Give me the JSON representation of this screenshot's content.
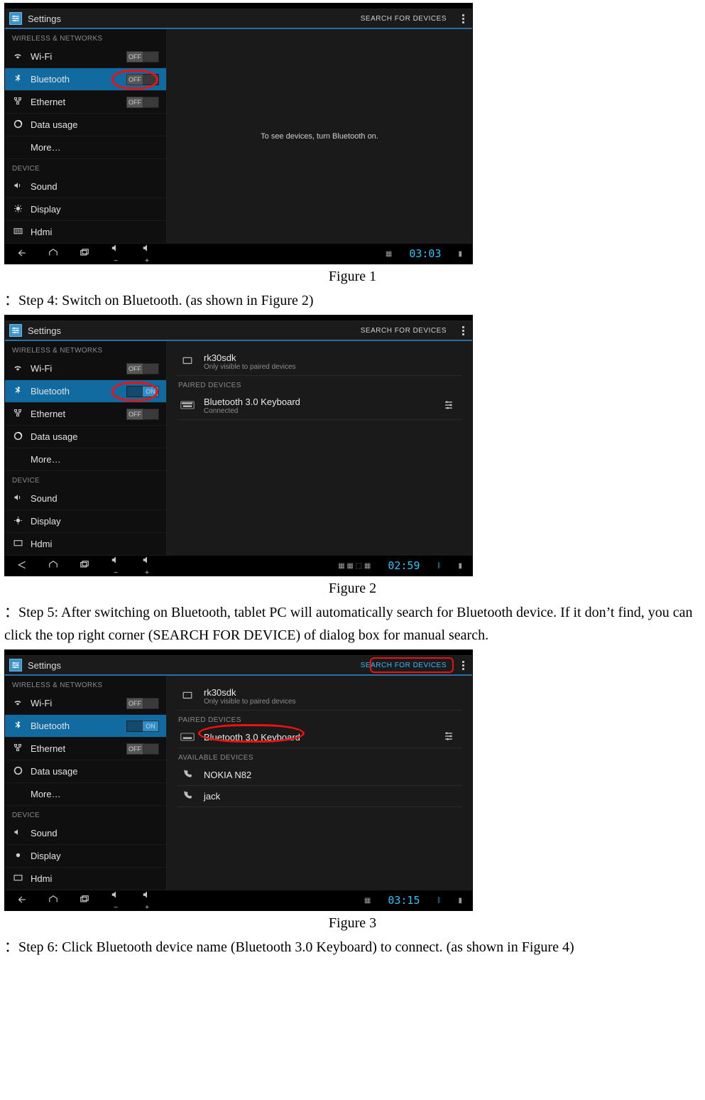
{
  "doc": {
    "captions": {
      "fig1": "Figure 1",
      "fig2": "Figure 2",
      "fig3": "Figure 3"
    },
    "steps": {
      "s4": "：Step 4: Switch on Bluetooth. (as shown in Figure 2)",
      "s5": "：Step 5: After switching on Bluetooth, tablet PC will automatically search for Bluetooth device. If it don’t find, you can click the top right corner (SEARCH FOR DEVICE) of dialog box for manual search.",
      "s6": "：Step 6: Click Bluetooth device name (Bluetooth 3.0 Keyboard) to connect. (as shown in Figure 4)"
    }
  },
  "common": {
    "app_title": "Settings",
    "search_action": "SEARCH FOR DEVICES",
    "cat_wireless": "WIRELESS & NETWORKS",
    "cat_device": "DEVICE",
    "items": {
      "wifi": "Wi-Fi",
      "bluetooth": "Bluetooth",
      "ethernet": "Ethernet",
      "data": "Data usage",
      "more": "More…",
      "sound": "Sound",
      "display": "Display",
      "hdmi": "Hdmi"
    },
    "toggle": {
      "on": "ON",
      "off": "OFF"
    }
  },
  "fig1": {
    "bt_state": "off",
    "content_msg": "To see devices, turn Bluetooth on.",
    "clock": "03:03"
  },
  "fig2": {
    "bt_state": "on",
    "self_name": "rk30sdk",
    "self_sub": "Only visible to paired devices",
    "section_paired": "PAIRED DEVICES",
    "paired": {
      "name": "Bluetooth 3.0 Keyboard",
      "sub": "Connected"
    },
    "clock": "02:59"
  },
  "fig3": {
    "bt_state": "on",
    "self_name": "rk30sdk",
    "self_sub": "Only visible to paired devices",
    "section_paired": "PAIRED DEVICES",
    "paired": {
      "name": "Bluetooth 3.0 Keyboard"
    },
    "section_avail": "AVAILABLE DEVICES",
    "avail": [
      {
        "name": "NOKIA N82"
      },
      {
        "name": "jack"
      }
    ],
    "clock": "03:15"
  }
}
